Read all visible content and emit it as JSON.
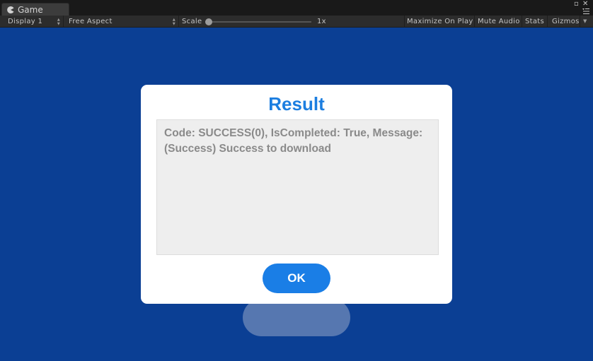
{
  "editor": {
    "tab_label": "Game",
    "tab_icon": "pacman-icon",
    "window_controls": {
      "maximize": "▫",
      "close": "✕"
    }
  },
  "toolbar": {
    "display": "Display 1",
    "aspect": "Free Aspect",
    "scale_label": "Scale",
    "scale_value": "1x",
    "scale_level": 0.0,
    "maximize_on_play": "Maximize On Play",
    "mute_audio": "Mute Audio",
    "stats": "Stats",
    "gizmos": "Gizmos"
  },
  "dialog": {
    "title": "Result",
    "message": "Code: SUCCESS(0), IsCompleted: True, Message: (Success) Success to download",
    "ok_label": "OK"
  },
  "colors": {
    "game_background": "#0b3f94",
    "accent": "#1a7ee6",
    "title": "#1c7ee0"
  }
}
